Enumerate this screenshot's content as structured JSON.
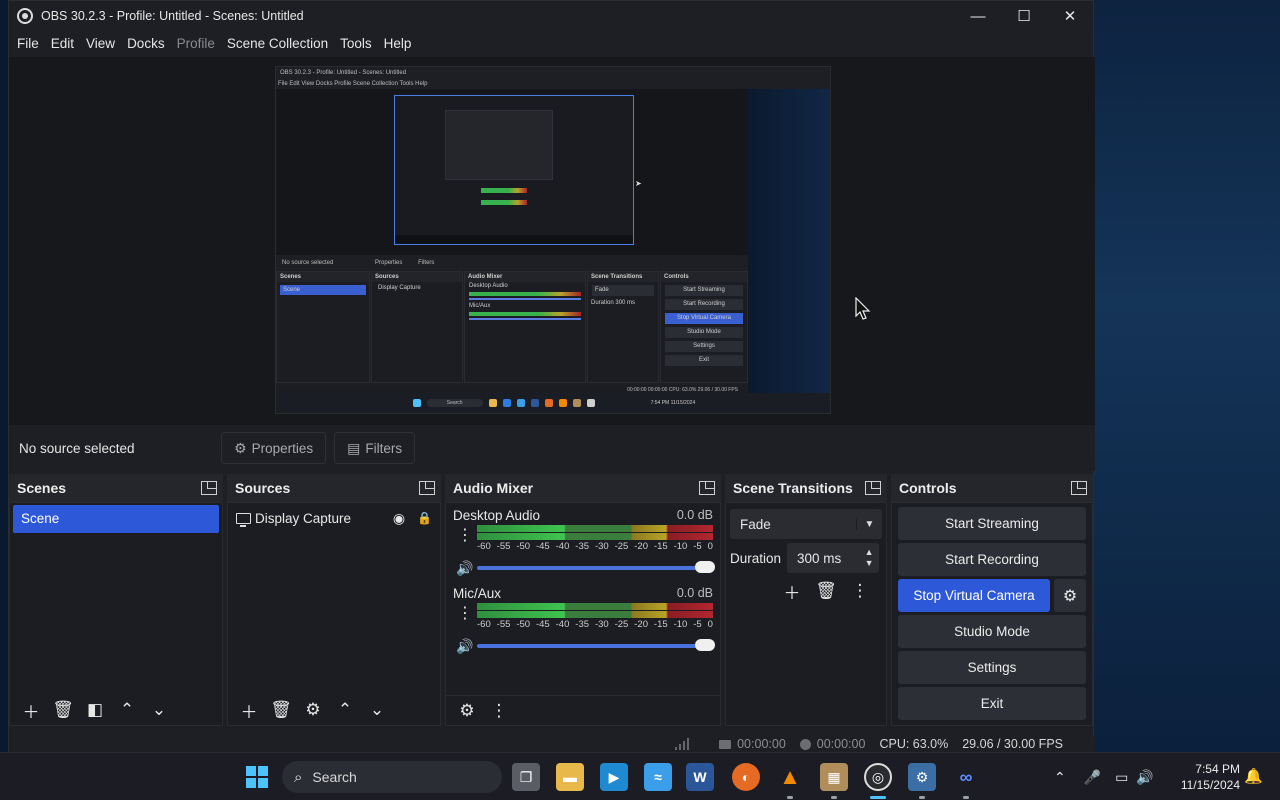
{
  "window": {
    "title": "OBS 30.2.3 - Profile: Untitled - Scenes: Untitled",
    "minimize": "—",
    "maximize": "☐",
    "close": "✕"
  },
  "menu": [
    {
      "label": "File"
    },
    {
      "label": "Edit"
    },
    {
      "label": "View"
    },
    {
      "label": "Docks"
    },
    {
      "label": "Profile",
      "disabled": true
    },
    {
      "label": "Scene Collection"
    },
    {
      "label": "Tools"
    },
    {
      "label": "Help"
    }
  ],
  "source_bar": {
    "status": "No source selected",
    "properties_label": "Properties",
    "filters_label": "Filters"
  },
  "scenes": {
    "title": "Scenes",
    "items": [
      "Scene"
    ]
  },
  "sources": {
    "title": "Sources",
    "items": [
      {
        "label": "Display Capture",
        "icon": "monitor-icon"
      }
    ]
  },
  "mixer": {
    "title": "Audio Mixer",
    "channels": [
      {
        "name": "Desktop Audio",
        "db": "0.0 dB"
      },
      {
        "name": "Mic/Aux",
        "db": "0.0 dB"
      }
    ],
    "scale": [
      "-60",
      "-55",
      "-50",
      "-45",
      "-40",
      "-35",
      "-30",
      "-25",
      "-20",
      "-15",
      "-10",
      "-5",
      "0"
    ],
    "volume_level": 1.0
  },
  "transitions": {
    "title": "Scene Transitions",
    "selected": "Fade",
    "duration_label": "Duration",
    "duration_value": "300 ms"
  },
  "controls": {
    "title": "Controls",
    "start_streaming": "Start Streaming",
    "start_recording": "Start Recording",
    "stop_virtual_camera": "Stop Virtual Camera",
    "studio_mode": "Studio Mode",
    "settings": "Settings",
    "exit": "Exit"
  },
  "status": {
    "stream_time": "00:00:00",
    "record_time": "00:00:00",
    "cpu": "CPU: 63.0%",
    "fps": "29.06 / 30.00 FPS"
  },
  "taskbar": {
    "search_placeholder": "Search",
    "time": "7:54 PM",
    "date": "11/15/2024"
  },
  "nested_preview": {
    "title": "OBS 30.2.3 - Profile: Untitled - Scenes: Untitled",
    "menu": "File  Edit  View  Docks  Profile  Scene Collection  Tools  Help",
    "no_source": "No source selected",
    "properties": "Properties",
    "filters": "Filters",
    "scenes": "Scenes",
    "scene": "Scene",
    "sources": "Sources",
    "display_capture": "Display Capture",
    "audio_mixer": "Audio Mixer",
    "desktop_audio": "Desktop Audio",
    "mic_aux": "Mic/Aux",
    "scene_transitions": "Scene Transitions",
    "fade": "Fade",
    "duration": "Duration",
    "duration_value": "300 ms",
    "controls": "Controls",
    "start_streaming": "Start Streaming",
    "start_recording": "Start Recording",
    "stop_virtual_camera": "Stop Virtual Camera",
    "studio_mode": "Studio Mode",
    "settings": "Settings",
    "exit": "Exit",
    "status": "00:00:00   00:00:00   CPU: 63.0%   29.06 / 30.00 FPS",
    "search": "Search",
    "clock": "7:54 PM 11/15/2024"
  },
  "colors": {
    "accent": "#2d58d8",
    "window_bg": "#1e1f24",
    "meter_green": "#3fc44f",
    "meter_yellow": "#b8a326",
    "meter_red": "#b3262f"
  }
}
